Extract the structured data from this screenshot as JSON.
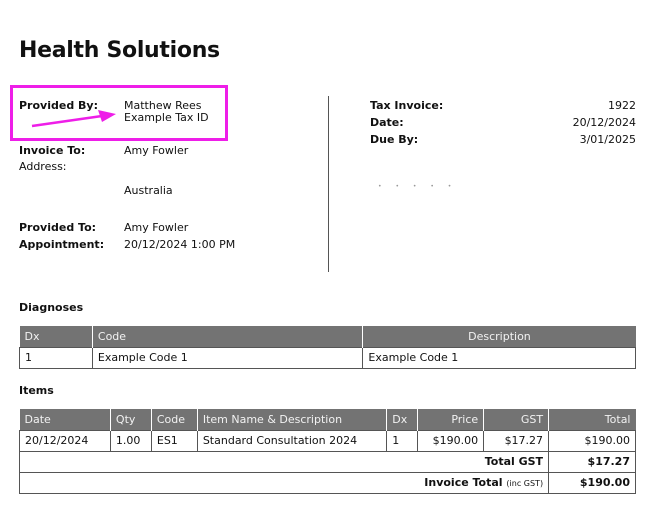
{
  "business_name": "Health Solutions",
  "provided_by": {
    "label": "Provided By:",
    "name": "Matthew Rees",
    "tax_id": "Example Tax ID"
  },
  "invoice_to": {
    "label": "Invoice To:",
    "name": "Amy Fowler",
    "address_label": "Address:",
    "country": "Australia"
  },
  "provided_to": {
    "label": "Provided To:",
    "name": "Amy Fowler"
  },
  "appointment": {
    "label": "Appointment:",
    "value": "20/12/2024 1:00 PM"
  },
  "invoice_meta": {
    "tax_invoice_label": "Tax Invoice:",
    "tax_invoice_value": "1922",
    "date_label": "Date:",
    "date_value": "20/12/2024",
    "due_label": "Due By:",
    "due_value": "3/01/2025"
  },
  "diagnoses": {
    "heading": "Diagnoses",
    "headers": {
      "dx": "Dx",
      "code": "Code",
      "description": "Description"
    },
    "rows": [
      {
        "dx": "1",
        "code": "Example Code 1",
        "description": "Example Code 1"
      }
    ]
  },
  "items": {
    "heading": "Items",
    "headers": {
      "date": "Date",
      "qty": "Qty",
      "code": "Code",
      "name": "Item Name & Description",
      "dx": "Dx",
      "price": "Price",
      "gst": "GST",
      "total": "Total"
    },
    "rows": [
      {
        "date": "20/12/2024",
        "qty": "1.00",
        "code": "ES1",
        "name": "Standard Consultation 2024",
        "dx": "1",
        "price": "$190.00",
        "gst": "$17.27",
        "total": "$190.00"
      }
    ],
    "total_gst_label": "Total GST",
    "total_gst_value": "$17.27",
    "invoice_total_label": "Invoice Total",
    "invoice_total_note": "(inc GST)",
    "invoice_total_value": "$190.00"
  },
  "annotation_color": "#ee1ee8"
}
